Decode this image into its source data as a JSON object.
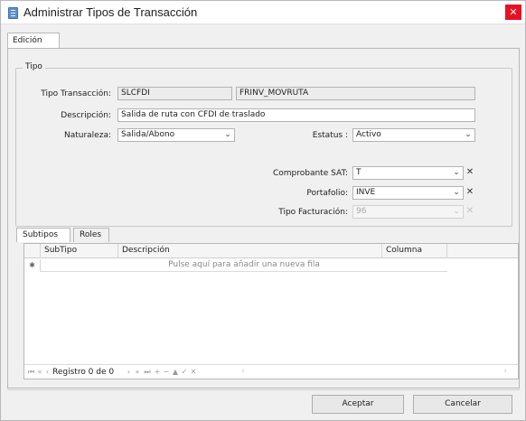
{
  "window": {
    "title": "Administrar Tipos de Transacción",
    "close_glyph": "✕"
  },
  "main_tab": {
    "label": "Edición"
  },
  "tipo_group": {
    "legend": "Tipo",
    "tipo_transaccion": {
      "label": "Tipo Transacción:",
      "code": "SLCFDI",
      "name": "FRINV_MOVRUTA"
    },
    "descripcion": {
      "label": "Descripción:",
      "value": "Salida de ruta con CFDI de traslado"
    },
    "naturaleza": {
      "label": "Naturaleza:",
      "value": "Salida/Abono"
    },
    "estatus": {
      "label": "Estatus :",
      "value": "Activo"
    },
    "comprobante_sat": {
      "label": "Comprobante SAT:",
      "value": "T"
    },
    "portafolio": {
      "label": "Portafolio:",
      "value": "INVE"
    },
    "tipo_facturacion": {
      "label": "Tipo Facturación:",
      "value": "96"
    }
  },
  "sub_tabs": [
    {
      "label": "Subtipos",
      "active": true
    },
    {
      "label": "Roles",
      "active": false
    }
  ],
  "grid": {
    "columns": [
      "SubTipo",
      "Descripción",
      "Columna"
    ],
    "new_row_indicator": "✱",
    "new_row_text": "Pulse aquí para añadir una nueva fila",
    "navigator": {
      "first": "⏮",
      "prev_page": "«",
      "prev": "‹",
      "record_text": "Registro 0 de 0",
      "next": "›",
      "next_page": "»",
      "last": "⏭",
      "add": "+",
      "delete": "−",
      "edit": "▲",
      "confirm": "✓",
      "cancel": "✕"
    },
    "scroll_left": "‹",
    "scroll_right": "›"
  },
  "icons": {
    "dropdown": "⌄",
    "clear": "✕"
  },
  "buttons": {
    "accept": "Aceptar",
    "cancel": "Cancelar"
  },
  "colors": {
    "close_button": "#e81123",
    "title_icon": "#5b8fd4"
  }
}
